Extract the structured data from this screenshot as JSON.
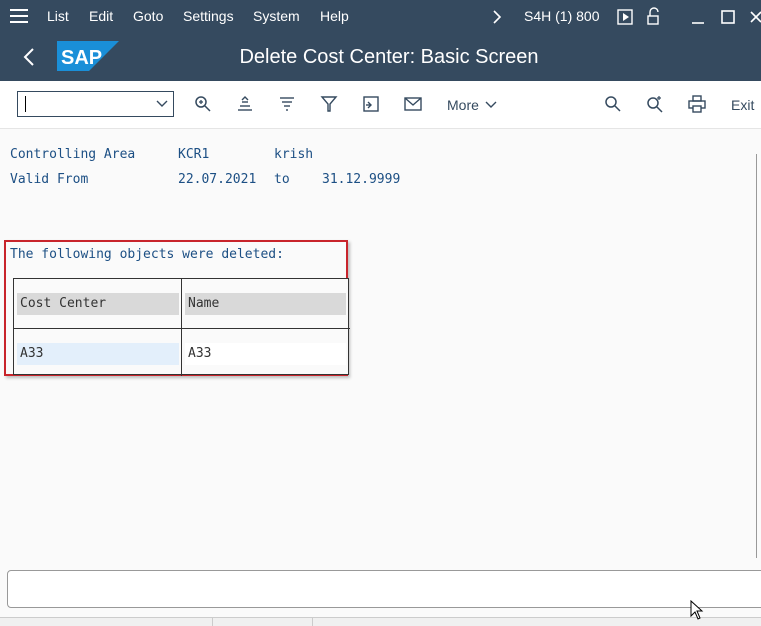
{
  "menu": {
    "items": [
      {
        "label": "List",
        "key": "L"
      },
      {
        "label": "Edit",
        "key": "E"
      },
      {
        "label": "Goto",
        "key": "G"
      },
      {
        "label": "Settings",
        "key": "S"
      },
      {
        "label": "System",
        "key": "S"
      },
      {
        "label": "Help",
        "key": "H"
      }
    ],
    "system": "S4H (1) 800"
  },
  "header": {
    "logo_text": "SAP",
    "title": "Delete Cost Center: Basic Screen"
  },
  "toolbar": {
    "command_field_value": "",
    "more_label": "More",
    "exit_label": "Exit"
  },
  "form": {
    "controlling_area_label": "Controlling Area",
    "controlling_area_value": "KCR1",
    "controlling_area_desc": "krish",
    "valid_from_label": "Valid From",
    "valid_from_value": "22.07.2021",
    "to_label": "to",
    "valid_to_value": "31.12.9999"
  },
  "deleted": {
    "heading": "The following objects were deleted:",
    "columns": [
      "Cost Center",
      "Name"
    ],
    "rows": [
      {
        "cost_center": "A33",
        "name": "A33"
      }
    ]
  },
  "colors": {
    "shell": "#354a5f",
    "highlight": "#c8242b",
    "selected_cell": "#e3effb"
  }
}
